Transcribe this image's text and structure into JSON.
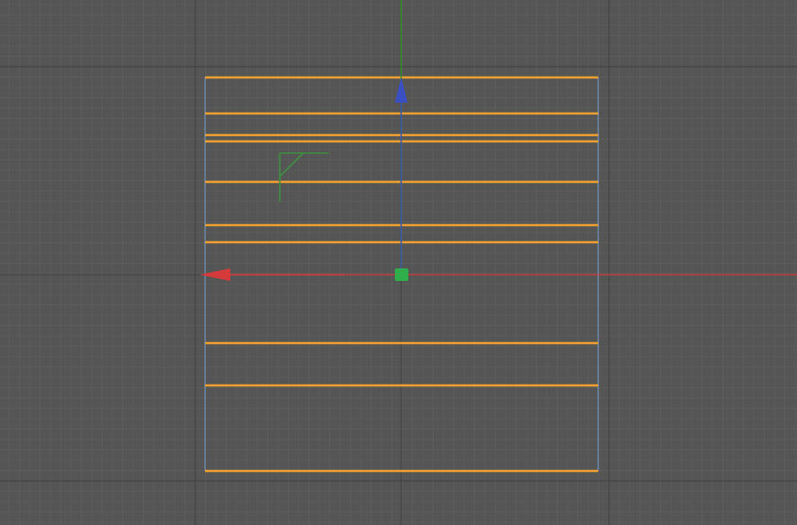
{
  "viewport": {
    "view": "top",
    "background_color": "#555555",
    "minor_grid_color": "#5c5c5c",
    "major_grid_color": "#444444"
  },
  "selection": {
    "edge_color": "#f0a030",
    "boundary_color": "#6f93b8",
    "horizontal_edge_count": 10
  },
  "gizmo": {
    "x_axis_color": "#d63a3a",
    "y_axis_color": "#2f8f2f",
    "z_axis_color": "#3b4fc4",
    "pivot_color": "#2fae4b",
    "plane_handle_color": "#3f8f3f"
  }
}
